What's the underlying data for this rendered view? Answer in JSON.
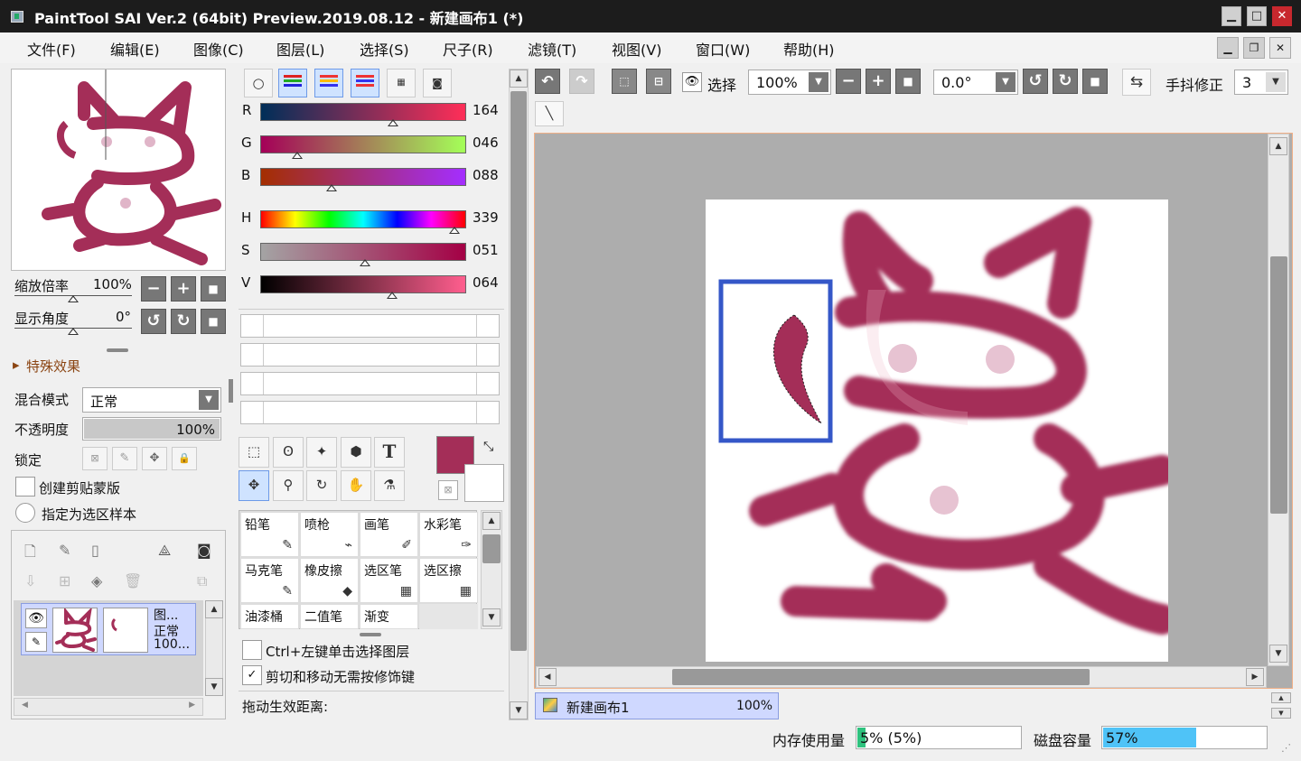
{
  "window": {
    "title": "PaintTool SAI Ver.2 (64bit) Preview.2019.08.12 - 新建画布1 (*)",
    "minimize": "▁",
    "maximize": "□",
    "close": "✕"
  },
  "menu": {
    "items": [
      "文件(F)",
      "编辑(E)",
      "图像(C)",
      "图层(L)",
      "选择(S)",
      "尺子(R)",
      "滤镜(T)",
      "视图(V)",
      "窗口(W)",
      "帮助(H)"
    ],
    "doc_minimize": "▁",
    "doc_restore": "❐",
    "doc_close": "✕"
  },
  "navigator": {
    "zoom_label": "缩放倍率",
    "zoom_value": "100%",
    "angle_label": "显示角度",
    "angle_value": "0°",
    "minus": "−",
    "plus": "+",
    "reset": "■",
    "rotate_ccw": "↺",
    "rotate_cw": "↻"
  },
  "layer_props": {
    "special_effects": "特殊效果",
    "blend_label": "混合模式",
    "blend_value": "正常",
    "opacity_label": "不透明度",
    "opacity_value": "100%",
    "opacity_fraction": 1.0,
    "lock_label": "锁定",
    "clip_label": "创建剪贴蒙版",
    "sample_label": "指定为选区样本"
  },
  "layers": {
    "items": [
      {
        "name": "图...",
        "mode": "正常",
        "opacity": "100..."
      }
    ]
  },
  "color": {
    "rgb": [
      {
        "label": "R",
        "value": "164",
        "fraction": 0.643
      },
      {
        "label": "G",
        "value": "046",
        "fraction": 0.18
      },
      {
        "label": "B",
        "value": "088",
        "fraction": 0.345
      }
    ],
    "hsv": [
      {
        "label": "H",
        "value": "339",
        "fraction": 0.942
      },
      {
        "label": "S",
        "value": "051",
        "fraction": 0.51
      },
      {
        "label": "V",
        "value": "064",
        "fraction": 0.64
      }
    ],
    "current": "#a42e58"
  },
  "tools": {
    "text_icon": "T",
    "brushes": [
      {
        "label": "铅笔",
        "icon": "✎"
      },
      {
        "label": "喷枪",
        "icon": "⌁"
      },
      {
        "label": "画笔",
        "icon": "✐"
      },
      {
        "label": "水彩笔",
        "icon": "✑"
      },
      {
        "label": "马克笔",
        "icon": "✎"
      },
      {
        "label": "橡皮擦",
        "icon": "◆"
      },
      {
        "label": "选区笔",
        "icon": "▦"
      },
      {
        "label": "选区擦",
        "icon": "▦"
      },
      {
        "label": "油漆桶",
        "icon": ""
      },
      {
        "label": "二值笔",
        "icon": ""
      },
      {
        "label": "渐变",
        "icon": ""
      }
    ],
    "ctrl_click_label": "Ctrl+左键单击选择图层",
    "no_modifier_label": "剪切和移动无需按修饰键",
    "no_modifier_check": "✓",
    "drag_distance_label": "拖动生效距离:"
  },
  "canvas_toolbar": {
    "select_label": "选择",
    "zoom_value": "100%",
    "angle_value": "0.0°",
    "stabilizer_label": "手抖修正",
    "stabilizer_value": "3",
    "minus": "−",
    "plus": "+",
    "reset": "■",
    "rotate_ccw": "↺",
    "rotate_cw": "↻",
    "undo": "↶",
    "redo": "↷",
    "flip": "⇆",
    "line_tool": "╲"
  },
  "canvas_tabs": [
    {
      "name": "新建画布1",
      "zoom": "100%"
    }
  ],
  "status": {
    "memory_label": "内存使用量",
    "memory_value": "5% (5%)",
    "memory_fraction": 0.05,
    "disk_label": "磁盘容量",
    "disk_value": "57%",
    "disk_fraction": 0.57
  },
  "colors": {
    "brush": "#a42e58",
    "selection_box": "#3557c8",
    "title_bg": "#1c1c1c",
    "disk_fill": "#4fc3f7",
    "memory_fill": "#2ec27e"
  }
}
